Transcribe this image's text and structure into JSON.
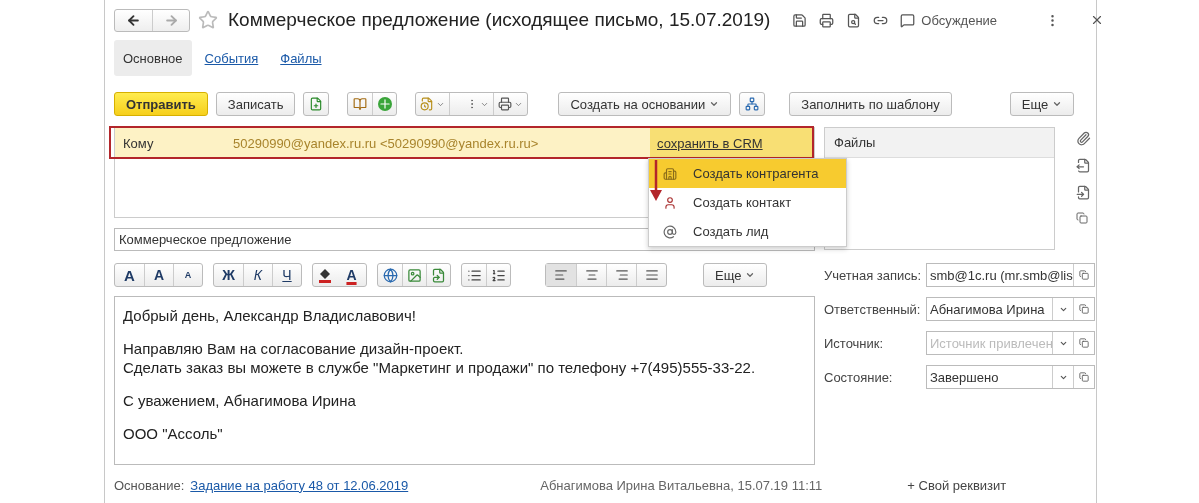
{
  "window": {
    "title": "Коммерческое предложение (исходящее письмо, 15.07.2019)",
    "discussion": "Обсуждение",
    "favorite": false
  },
  "tabs": [
    {
      "label": "Основное",
      "selected": true
    },
    {
      "label": "События",
      "selected": false
    },
    {
      "label": "Файлы",
      "selected": false
    }
  ],
  "toolbar": [
    {
      "label": "Отправить",
      "kind": "primary"
    },
    {
      "label": "Записать",
      "kind": "button"
    },
    {
      "label": "Создать на основании",
      "kind": "dropdown"
    },
    {
      "label": "Заполнить по шаблону",
      "kind": "button"
    },
    {
      "label": "Еще",
      "kind": "dropdown"
    }
  ],
  "recipient": {
    "label": "Кому",
    "value": "50290990@yandex.ru.ru <50290990@yandex.ru.ru>",
    "action": "сохранить в CRM",
    "highlighted": true
  },
  "crm_menu": [
    {
      "label": "Создать контрагента",
      "selected": true
    },
    {
      "label": "Создать контакт",
      "selected": false
    },
    {
      "label": "Создать лид",
      "selected": false
    }
  ],
  "files_panel": {
    "title": "Файлы"
  },
  "subject": {
    "value": "Коммерческое предложение"
  },
  "format_toolbar": {
    "font_buttons": [
      "A",
      "A",
      "A"
    ],
    "style_buttons": [
      "Ж",
      "К",
      "Ч"
    ],
    "color_buttons": [
      "A"
    ],
    "more": "Еще",
    "alignment": [
      {
        "selected": true
      },
      {
        "selected": false
      },
      {
        "selected": false
      },
      {
        "selected": false
      }
    ]
  },
  "body": [
    [
      "Добрый день, Александр Владиславович!"
    ],
    [
      "Направляю Вам на согласование дизайн-проект.",
      "Сделать заказ вы можете в службе \"Маркетинг и продажи\" по телефону +7(495)555-33-22."
    ],
    [
      "С уважением, Абнагимова Ирина"
    ],
    [
      "ООО \"Ассоль\""
    ]
  ],
  "fields": [
    {
      "label": "Учетная запись:",
      "value": "smb@1c.ru (mr.smb@lis",
      "kind": "text"
    },
    {
      "label": "Ответственный:",
      "value": "Абнагимова Ирина",
      "kind": "select"
    },
    {
      "label": "Источник:",
      "placeholder": "Источник привлечен",
      "kind": "select"
    },
    {
      "label": "Состояние:",
      "value": "Завершено",
      "kind": "select"
    }
  ],
  "footer": {
    "basis_label": "Основание:",
    "basis_link": "Задание на работу 48 от 12.06.2019",
    "author": "Абнагимова Ирина Витальевна, 15.07.19 11:11",
    "add_attribute": "+ Свой реквизит"
  }
}
